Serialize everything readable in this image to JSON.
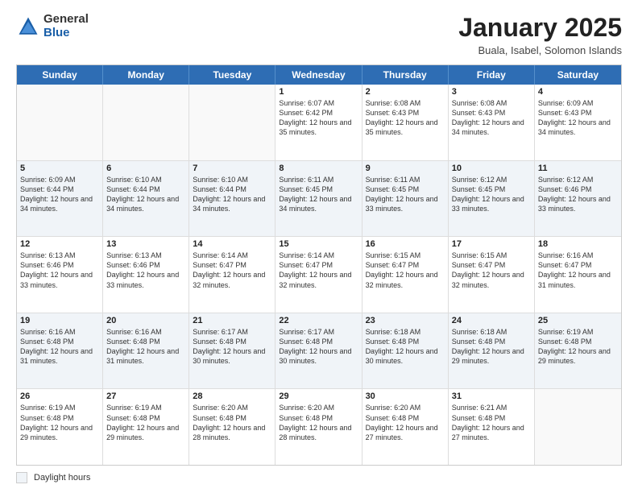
{
  "logo": {
    "general": "General",
    "blue": "Blue"
  },
  "title": "January 2025",
  "subtitle": "Buala, Isabel, Solomon Islands",
  "days_of_week": [
    "Sunday",
    "Monday",
    "Tuesday",
    "Wednesday",
    "Thursday",
    "Friday",
    "Saturday"
  ],
  "legend_label": "Daylight hours",
  "weeks": [
    [
      {
        "day": "",
        "info": "",
        "empty": true
      },
      {
        "day": "",
        "info": "",
        "empty": true
      },
      {
        "day": "",
        "info": "",
        "empty": true
      },
      {
        "day": "1",
        "info": "Sunrise: 6:07 AM\nSunset: 6:42 PM\nDaylight: 12 hours\nand 35 minutes."
      },
      {
        "day": "2",
        "info": "Sunrise: 6:08 AM\nSunset: 6:43 PM\nDaylight: 12 hours\nand 35 minutes."
      },
      {
        "day": "3",
        "info": "Sunrise: 6:08 AM\nSunset: 6:43 PM\nDaylight: 12 hours\nand 34 minutes."
      },
      {
        "day": "4",
        "info": "Sunrise: 6:09 AM\nSunset: 6:43 PM\nDaylight: 12 hours\nand 34 minutes."
      }
    ],
    [
      {
        "day": "5",
        "info": "Sunrise: 6:09 AM\nSunset: 6:44 PM\nDaylight: 12 hours\nand 34 minutes.",
        "shaded": true
      },
      {
        "day": "6",
        "info": "Sunrise: 6:10 AM\nSunset: 6:44 PM\nDaylight: 12 hours\nand 34 minutes.",
        "shaded": true
      },
      {
        "day": "7",
        "info": "Sunrise: 6:10 AM\nSunset: 6:44 PM\nDaylight: 12 hours\nand 34 minutes.",
        "shaded": true
      },
      {
        "day": "8",
        "info": "Sunrise: 6:11 AM\nSunset: 6:45 PM\nDaylight: 12 hours\nand 34 minutes.",
        "shaded": true
      },
      {
        "day": "9",
        "info": "Sunrise: 6:11 AM\nSunset: 6:45 PM\nDaylight: 12 hours\nand 33 minutes.",
        "shaded": true
      },
      {
        "day": "10",
        "info": "Sunrise: 6:12 AM\nSunset: 6:45 PM\nDaylight: 12 hours\nand 33 minutes.",
        "shaded": true
      },
      {
        "day": "11",
        "info": "Sunrise: 6:12 AM\nSunset: 6:46 PM\nDaylight: 12 hours\nand 33 minutes.",
        "shaded": true
      }
    ],
    [
      {
        "day": "12",
        "info": "Sunrise: 6:13 AM\nSunset: 6:46 PM\nDaylight: 12 hours\nand 33 minutes."
      },
      {
        "day": "13",
        "info": "Sunrise: 6:13 AM\nSunset: 6:46 PM\nDaylight: 12 hours\nand 33 minutes."
      },
      {
        "day": "14",
        "info": "Sunrise: 6:14 AM\nSunset: 6:47 PM\nDaylight: 12 hours\nand 32 minutes."
      },
      {
        "day": "15",
        "info": "Sunrise: 6:14 AM\nSunset: 6:47 PM\nDaylight: 12 hours\nand 32 minutes."
      },
      {
        "day": "16",
        "info": "Sunrise: 6:15 AM\nSunset: 6:47 PM\nDaylight: 12 hours\nand 32 minutes."
      },
      {
        "day": "17",
        "info": "Sunrise: 6:15 AM\nSunset: 6:47 PM\nDaylight: 12 hours\nand 32 minutes."
      },
      {
        "day": "18",
        "info": "Sunrise: 6:16 AM\nSunset: 6:47 PM\nDaylight: 12 hours\nand 31 minutes."
      }
    ],
    [
      {
        "day": "19",
        "info": "Sunrise: 6:16 AM\nSunset: 6:48 PM\nDaylight: 12 hours\nand 31 minutes.",
        "shaded": true
      },
      {
        "day": "20",
        "info": "Sunrise: 6:16 AM\nSunset: 6:48 PM\nDaylight: 12 hours\nand 31 minutes.",
        "shaded": true
      },
      {
        "day": "21",
        "info": "Sunrise: 6:17 AM\nSunset: 6:48 PM\nDaylight: 12 hours\nand 30 minutes.",
        "shaded": true
      },
      {
        "day": "22",
        "info": "Sunrise: 6:17 AM\nSunset: 6:48 PM\nDaylight: 12 hours\nand 30 minutes.",
        "shaded": true
      },
      {
        "day": "23",
        "info": "Sunrise: 6:18 AM\nSunset: 6:48 PM\nDaylight: 12 hours\nand 30 minutes.",
        "shaded": true
      },
      {
        "day": "24",
        "info": "Sunrise: 6:18 AM\nSunset: 6:48 PM\nDaylight: 12 hours\nand 29 minutes.",
        "shaded": true
      },
      {
        "day": "25",
        "info": "Sunrise: 6:19 AM\nSunset: 6:48 PM\nDaylight: 12 hours\nand 29 minutes.",
        "shaded": true
      }
    ],
    [
      {
        "day": "26",
        "info": "Sunrise: 6:19 AM\nSunset: 6:48 PM\nDaylight: 12 hours\nand 29 minutes."
      },
      {
        "day": "27",
        "info": "Sunrise: 6:19 AM\nSunset: 6:48 PM\nDaylight: 12 hours\nand 29 minutes."
      },
      {
        "day": "28",
        "info": "Sunrise: 6:20 AM\nSunset: 6:48 PM\nDaylight: 12 hours\nand 28 minutes."
      },
      {
        "day": "29",
        "info": "Sunrise: 6:20 AM\nSunset: 6:48 PM\nDaylight: 12 hours\nand 28 minutes."
      },
      {
        "day": "30",
        "info": "Sunrise: 6:20 AM\nSunset: 6:48 PM\nDaylight: 12 hours\nand 27 minutes."
      },
      {
        "day": "31",
        "info": "Sunrise: 6:21 AM\nSunset: 6:48 PM\nDaylight: 12 hours\nand 27 minutes."
      },
      {
        "day": "",
        "info": "",
        "empty": true
      }
    ]
  ]
}
